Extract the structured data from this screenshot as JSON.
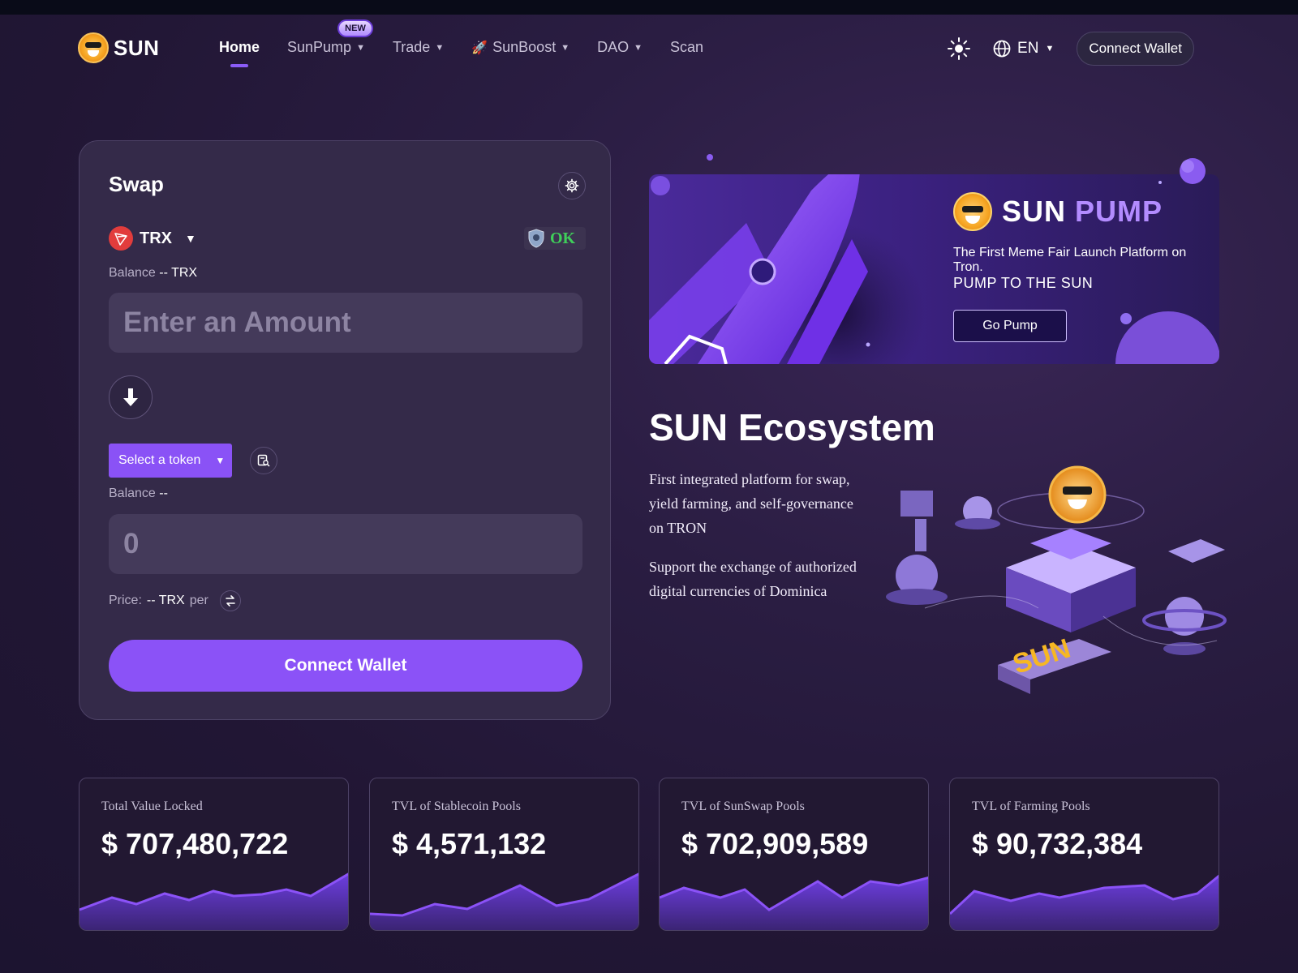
{
  "nav": {
    "brand": "SUN",
    "items": [
      {
        "label": "Home",
        "active": true,
        "dropdown": false
      },
      {
        "label": "SunPump",
        "active": false,
        "dropdown": true,
        "badge": "NEW"
      },
      {
        "label": "Trade",
        "active": false,
        "dropdown": true
      },
      {
        "label": "SunBoost",
        "active": false,
        "dropdown": true,
        "icon": "rocket-icon"
      },
      {
        "label": "DAO",
        "active": false,
        "dropdown": true
      },
      {
        "label": "Scan",
        "active": false,
        "dropdown": false
      }
    ],
    "theme_icon": "sun-icon",
    "language": "EN",
    "connect_label": "Connect Wallet"
  },
  "swap": {
    "title": "Swap",
    "from_token": "TRX",
    "verify_status": "OK",
    "from_balance_label": "Balance",
    "from_balance_value": "-- TRX",
    "amount_placeholder": "Enter an Amount",
    "select_token_label": "Select a token",
    "to_balance_label": "Balance",
    "to_balance_value": "--",
    "to_amount_placeholder": "0",
    "price_label": "Price:",
    "price_value": "-- TRX",
    "price_suffix": "per",
    "connect_label": "Connect Wallet"
  },
  "banner": {
    "brand_first": "SUN",
    "brand_second": "PUMP",
    "subtitle": "The First Meme Fair Launch Platform on Tron.",
    "tagline": "PUMP TO THE SUN",
    "cta": "Go Pump"
  },
  "ecosystem": {
    "title": "SUN Ecosystem",
    "paragraph1": "First integrated platform for swap, yield farming, and self-governance on TRON",
    "paragraph2": "Support the exchange of authorized digital currencies of Dominica"
  },
  "stats": [
    {
      "label": "Total Value Locked",
      "value": "$ 707,480,722"
    },
    {
      "label": "TVL of Stablecoin Pools",
      "value": "$ 4,571,132"
    },
    {
      "label": "TVL of SunSwap Pools",
      "value": "$ 702,909,589"
    },
    {
      "label": "TVL of Farming Pools",
      "value": "$ 90,732,384"
    }
  ],
  "colors": {
    "accent": "#8b52f7",
    "background": "#211634",
    "card": "#342a49",
    "ok_green": "#3fcf5a"
  }
}
